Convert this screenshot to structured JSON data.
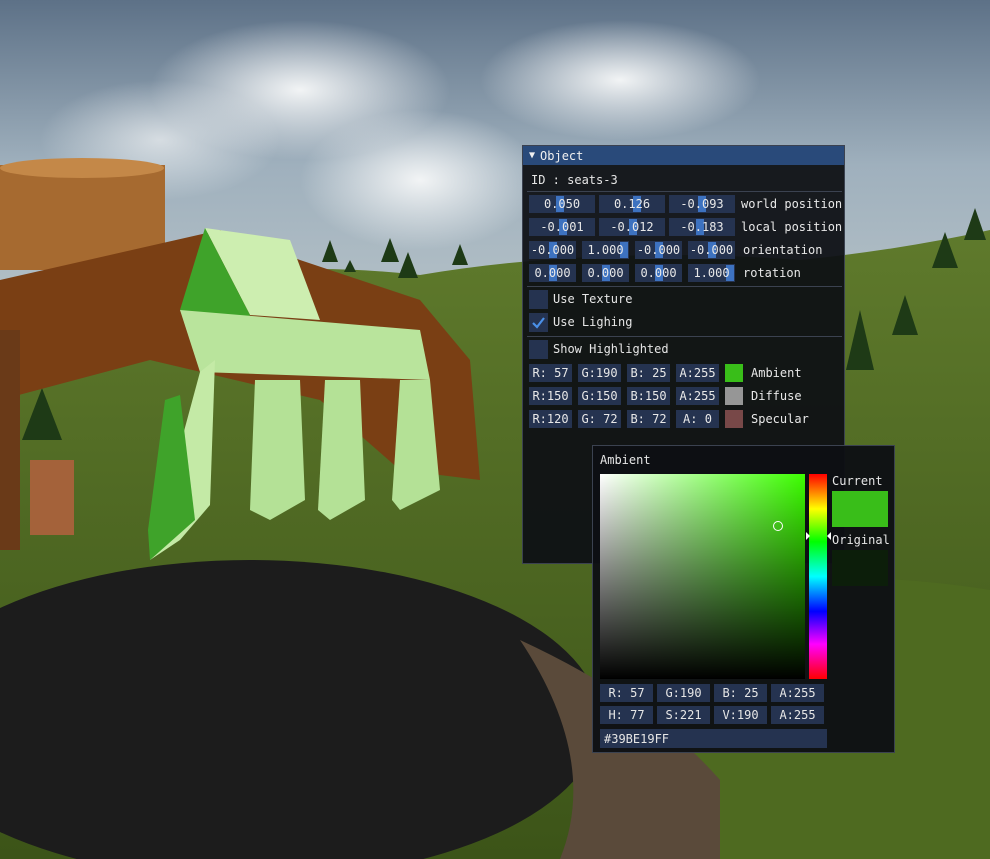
{
  "object_panel": {
    "title": "Object",
    "id_line": "ID : seats-3",
    "transform_rows": [
      {
        "values": [
          "0.050",
          "0.126",
          "-0.093"
        ],
        "label": "world position"
      },
      {
        "values": [
          "-0.001",
          "-0.012",
          "-0.183"
        ],
        "label": "local position"
      },
      {
        "values": [
          "-0.000",
          "1.000",
          "-0.000",
          "-0.000"
        ],
        "label": "orientation"
      },
      {
        "values": [
          "0.000",
          "0.000",
          "0.000",
          "1.000"
        ],
        "label": "rotation"
      }
    ],
    "checkboxes": [
      {
        "label": "Use Texture",
        "checked": false
      },
      {
        "label": "Use Lighing",
        "checked": true
      },
      {
        "label": "Show Highlighted",
        "checked": false
      }
    ],
    "color_rows": [
      {
        "r": "R: 57",
        "g": "G:190",
        "b": "B: 25",
        "a": "A:255",
        "label": "Ambient",
        "color": "#39BE19"
      },
      {
        "r": "R:150",
        "g": "G:150",
        "b": "B:150",
        "a": "A:255",
        "label": "Diffuse",
        "color": "#969696"
      },
      {
        "r": "R:120",
        "g": "G: 72",
        "b": "B: 72",
        "a": "A:  0",
        "label": "Specular",
        "color": "#784848"
      }
    ]
  },
  "color_picker": {
    "title": "Ambient",
    "current_label": "Current",
    "original_label": "Original",
    "current_color": "#39BE19",
    "original_color": "#0c1e0a",
    "rgba_fields": [
      "R: 57",
      "G:190",
      "B: 25",
      "A:255"
    ],
    "hsva_fields": [
      "H: 77",
      "S:221",
      "V:190",
      "A:255"
    ],
    "hex_value": "#39BE19FF"
  }
}
